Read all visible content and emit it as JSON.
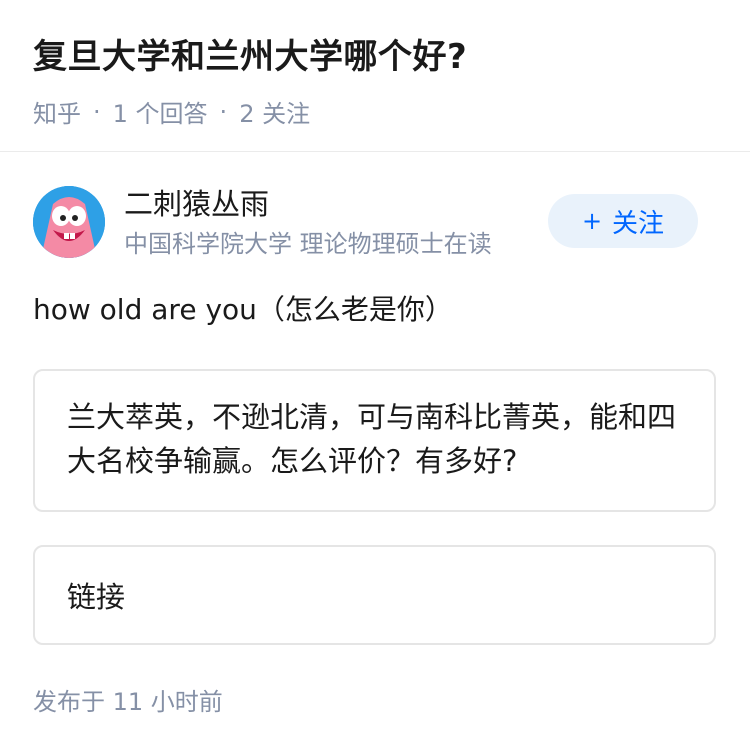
{
  "question": {
    "title": "复旦大学和兰州大学哪个好?",
    "source": "知乎",
    "answer_count": "1 个回答",
    "follower_count": "2 关注"
  },
  "author": {
    "name": "二刺猿丛雨",
    "bio": "中国科学院大学 理论物理硕士在读",
    "follow_label": "关注",
    "follow_icon": "plus-icon"
  },
  "answer": {
    "text": "how old are you（怎么老是你）",
    "quote": "兰大萃英，不逊北清，可与南科比菁英，能和四大名校争输赢。怎么评价？有多好?",
    "link_label": "链接",
    "published": "发布于  11 小时前"
  },
  "colors": {
    "accent": "#0066ff",
    "follow_bg": "#e9f2fb",
    "muted": "#8590a6",
    "avatar_bg": "#1f8fd8"
  }
}
